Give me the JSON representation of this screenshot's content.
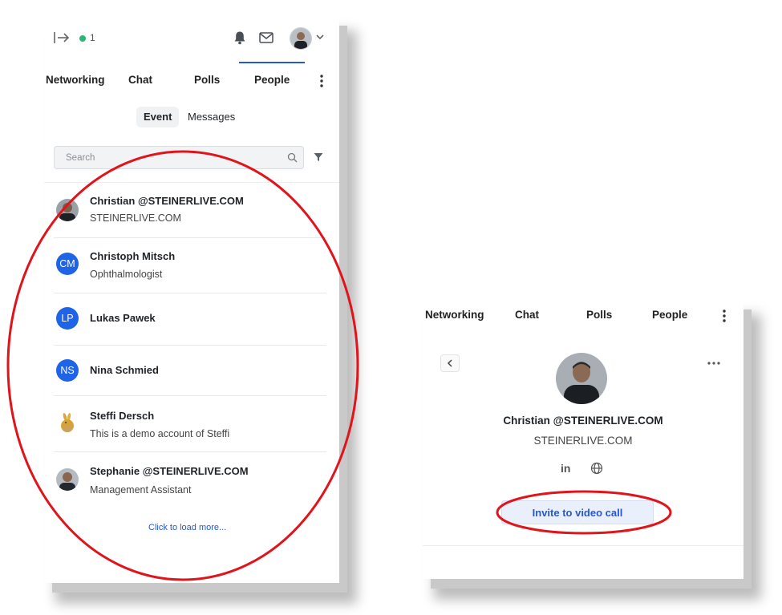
{
  "left_panel": {
    "online_count": "1",
    "tabs": [
      "Networking",
      "Chat",
      "Polls",
      "People"
    ],
    "active_tab": "People",
    "segments": [
      "Event",
      "Messages"
    ],
    "active_segment": "Event",
    "search": {
      "placeholder": "Search",
      "value": ""
    },
    "people": [
      {
        "name": "Christian @STEINERLIVE.COM",
        "subtitle": "STEINERLIVE.COM",
        "avatar": "photo"
      },
      {
        "name": "Christoph Mitsch",
        "subtitle": "Ophthalmologist",
        "initials": "CM"
      },
      {
        "name": "Lukas Pawek",
        "subtitle": "",
        "initials": "LP"
      },
      {
        "name": "Nina Schmied",
        "subtitle": "",
        "initials": "NS"
      },
      {
        "name": "Steffi Dersch",
        "subtitle": "This is a demo account of Steffi",
        "avatar": "bunny"
      },
      {
        "name": "Stephanie @STEINERLIVE.COM",
        "subtitle": "Management Assistant",
        "avatar": "photo"
      }
    ],
    "load_more": "Click to load more..."
  },
  "right_panel": {
    "tabs": [
      "Networking",
      "Chat",
      "Polls",
      "People"
    ],
    "profile": {
      "name": "Christian @STEINERLIVE.COM",
      "company": "STEINERLIVE.COM",
      "linkedin_label": "in",
      "invite_label": "Invite to video call"
    }
  },
  "colors": {
    "accent": "#2557d6",
    "initials_bg": "#1f63e6",
    "online": "#2bb673",
    "highlight": "#e0141b"
  },
  "icons": [
    "exit-icon",
    "bell-icon",
    "mail-icon",
    "chevron-down-icon",
    "more-vertical-icon",
    "search-icon",
    "filter-icon",
    "back-icon",
    "more-horizontal-icon",
    "linkedin-icon",
    "globe-icon"
  ]
}
